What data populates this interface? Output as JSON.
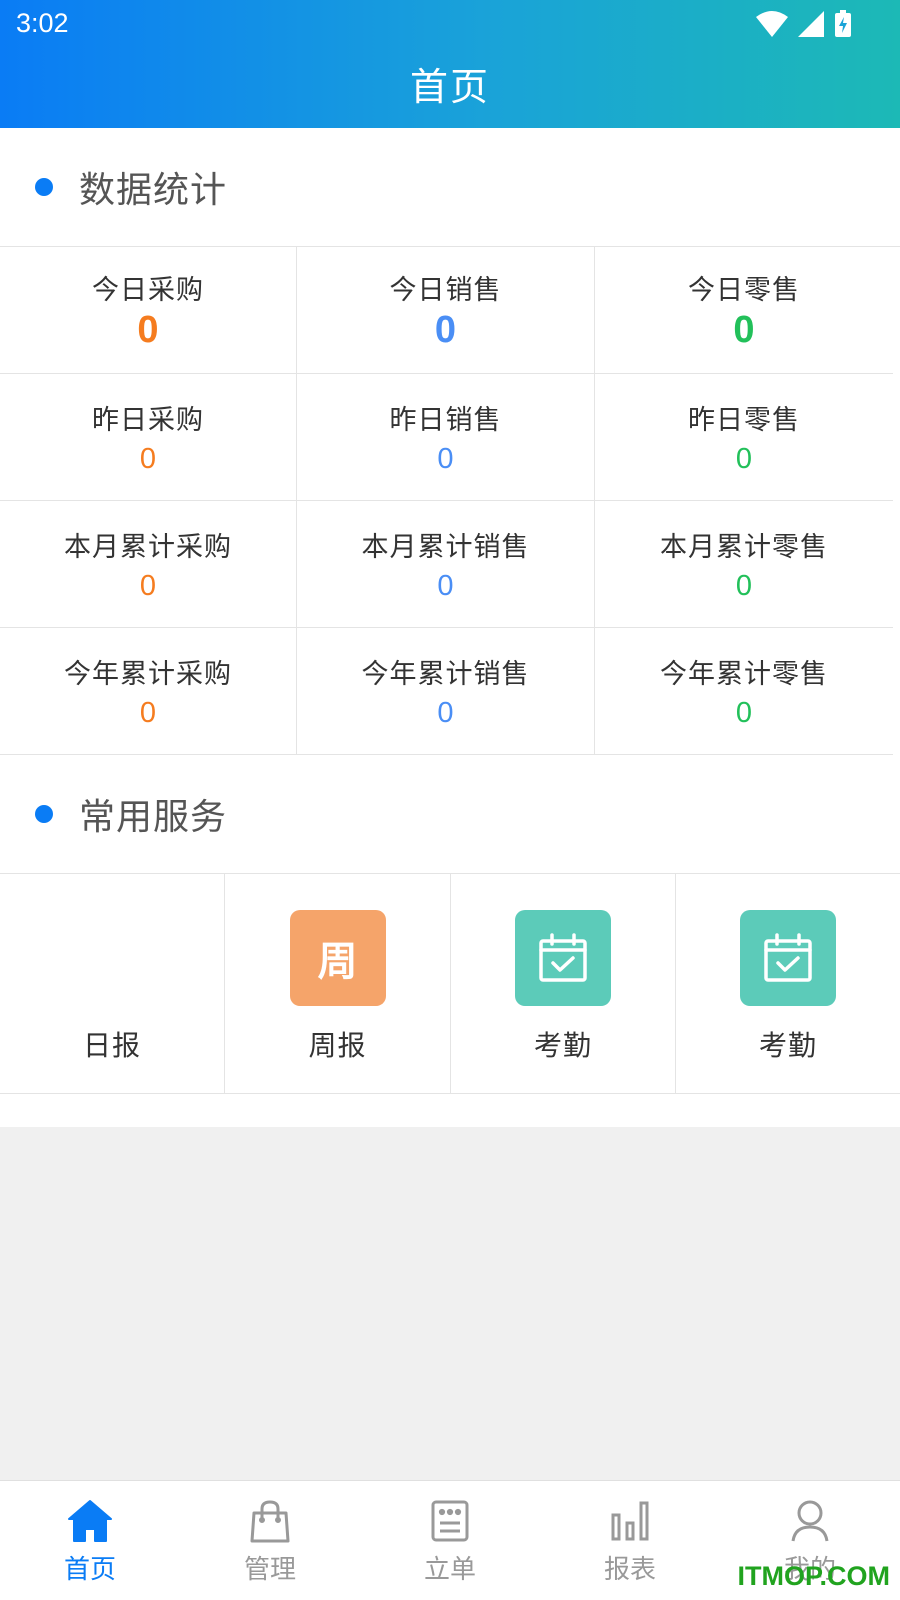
{
  "status_bar": {
    "time": "3:02"
  },
  "header": {
    "title": "首页"
  },
  "stats_section": {
    "title": "数据统计",
    "rows": [
      [
        {
          "label": "今日采购",
          "value": "0"
        },
        {
          "label": "今日销售",
          "value": "0"
        },
        {
          "label": "今日零售",
          "value": "0"
        }
      ],
      [
        {
          "label": "昨日采购",
          "value": "0"
        },
        {
          "label": "昨日销售",
          "value": "0"
        },
        {
          "label": "昨日零售",
          "value": "0"
        }
      ],
      [
        {
          "label": "本月累计采购",
          "value": "0"
        },
        {
          "label": "本月累计销售",
          "value": "0"
        },
        {
          "label": "本月累计零售",
          "value": "0"
        }
      ],
      [
        {
          "label": "今年累计采购",
          "value": "0"
        },
        {
          "label": "今年累计销售",
          "value": "0"
        },
        {
          "label": "今年累计零售",
          "value": "0"
        }
      ]
    ]
  },
  "colors": {
    "purchase": "#f57c1f",
    "sales": "#4a8ef5",
    "retail": "#22c05a",
    "accent": "#0a7cf5"
  },
  "services_section": {
    "title": "常用服务",
    "items": [
      {
        "label": "日报",
        "icon": "blank"
      },
      {
        "label": "周报",
        "icon": "week-icon",
        "glyph": "周"
      },
      {
        "label": "考勤",
        "icon": "calendar-check-icon"
      },
      {
        "label": "考勤",
        "icon": "calendar-check-icon"
      }
    ]
  },
  "tabbar": {
    "items": [
      {
        "label": "首页",
        "icon": "home-icon",
        "active": true
      },
      {
        "label": "管理",
        "icon": "shopping-bag-icon",
        "active": false
      },
      {
        "label": "立单",
        "icon": "order-form-icon",
        "active": false
      },
      {
        "label": "报表",
        "icon": "bar-chart-icon",
        "active": false
      },
      {
        "label": "我的",
        "icon": "user-icon",
        "active": false
      }
    ]
  },
  "watermark": "ITMOP.COM"
}
